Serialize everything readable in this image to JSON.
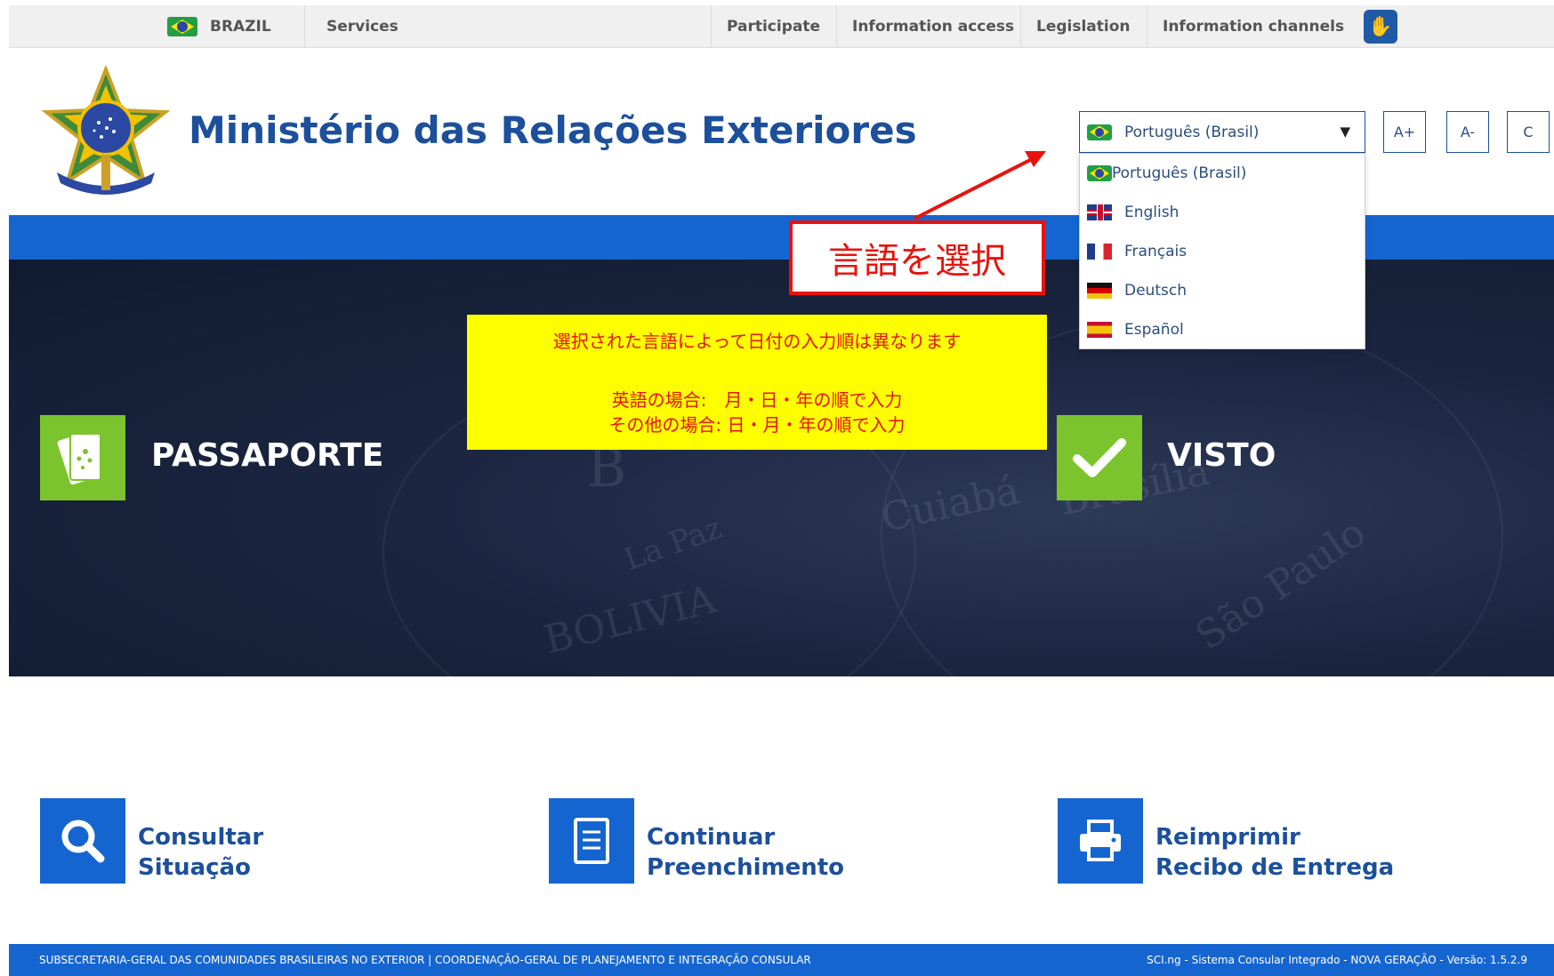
{
  "govbar": {
    "country": "BRAZIL",
    "services": "Services",
    "participate": "Participate",
    "info_access": "Information access",
    "legislation": "Legislation",
    "info_channels": "Information channels"
  },
  "header": {
    "title": "Ministério das Relações Exteriores"
  },
  "language": {
    "selected": "Português (Brasil)",
    "options": [
      {
        "label": "Português (Brasil)",
        "flag": "brazil-flag-icon"
      },
      {
        "label": "English",
        "flag": "uk-flag-icon"
      },
      {
        "label": "Français",
        "flag": "france-flag-icon"
      },
      {
        "label": "Deutsch",
        "flag": "germany-flag-icon"
      },
      {
        "label": "Español",
        "flag": "spain-flag-icon"
      }
    ]
  },
  "font_controls": {
    "increase": "A+",
    "decrease": "A-",
    "contrast": "C"
  },
  "annotation": {
    "select_language": "言語を選択",
    "note_line1": "選択された言語によって日付の入力順は異なります",
    "note_line2": "英語の場合:　月・日・年の順で入力",
    "note_line3": "その他の場合: 日・月・年の順で入力"
  },
  "hero": {
    "passport": "PASSAPORTE",
    "visa": "VISTO",
    "map_words": [
      "Cuiabá",
      "Brasília",
      "São Paulo",
      "BOLIVIA",
      "La Paz",
      "B"
    ]
  },
  "actions": [
    {
      "line1": "Consultar",
      "line2": "Situação",
      "icon": "search-icon"
    },
    {
      "line1": "Continuar",
      "line2": "Preenchimento",
      "icon": "document-icon"
    },
    {
      "line1": "Reimprimir",
      "line2": "Recibo de Entrega",
      "icon": "printer-icon"
    }
  ],
  "footer": {
    "left": "SUBSECRETARIA-GERAL DAS COMUNIDADES BRASILEIRAS NO EXTERIOR | COORDENAÇÃO-GERAL DE PLANEJAMENTO E INTEGRAÇÃO CONSULAR",
    "right": "SCI.ng - Sistema Consular Integrado - NOVA GERAÇÃO - Versão: 1.5.2.9"
  },
  "colors": {
    "primary_blue": "#1565d1",
    "title_blue": "#1c4f9c",
    "green_tile": "#7cc42d",
    "annotation_red": "#e8130c",
    "note_yellow": "#ffff00"
  }
}
